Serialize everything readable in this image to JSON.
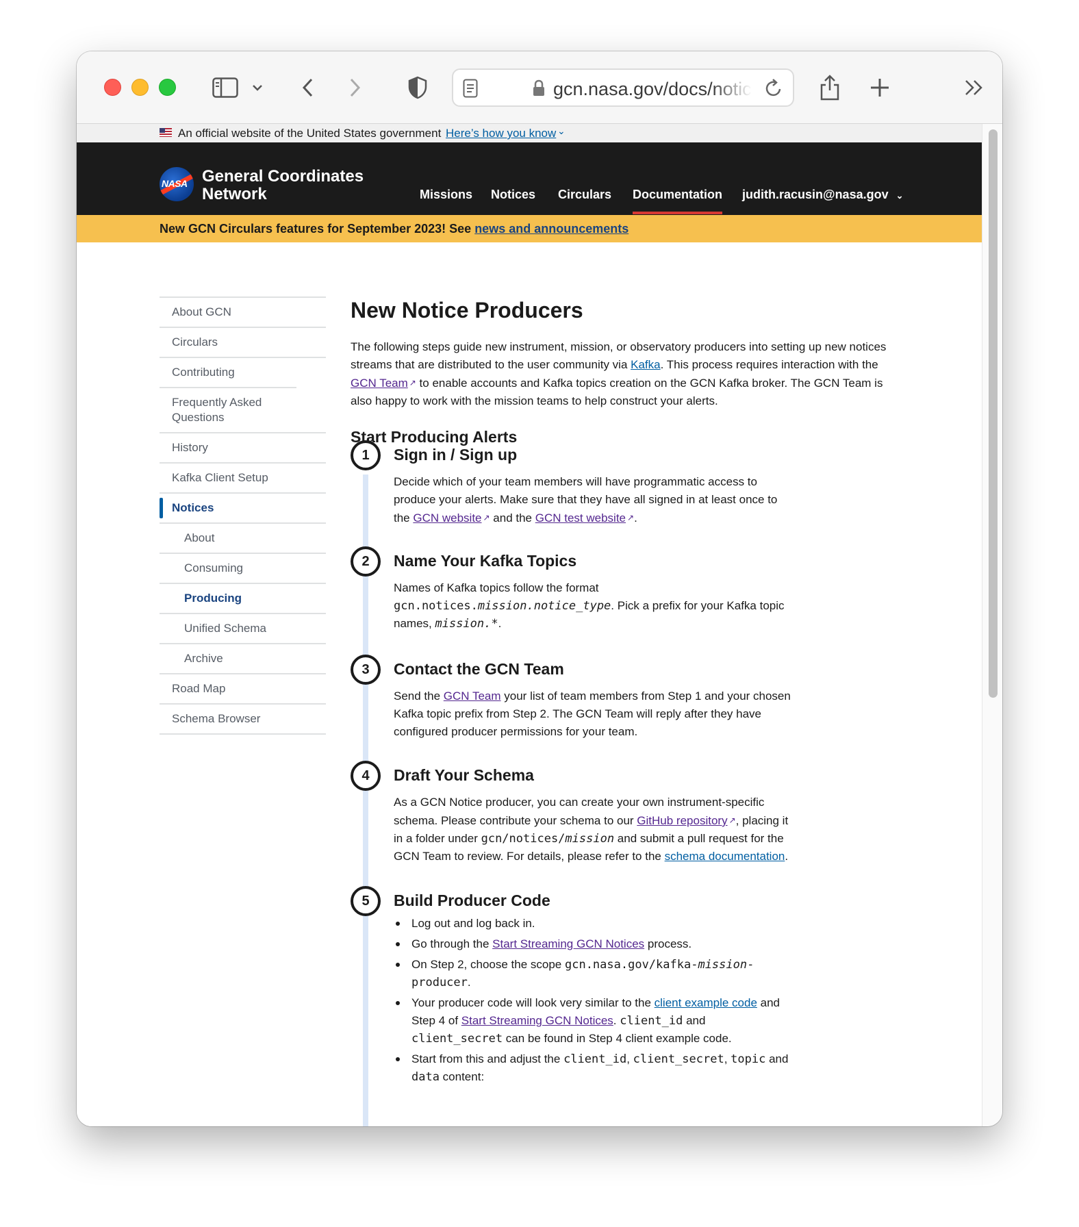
{
  "browser": {
    "url": "gcn.nasa.gov/docs/notices/producers"
  },
  "gov_banner": {
    "text": "An official website of the United States government",
    "link": "Here’s how you know"
  },
  "header": {
    "site_title_line1": "General Coordinates",
    "site_title_line2": "Network",
    "nav": [
      "Missions",
      "Notices",
      "Circulars",
      "Documentation",
      "judith.racusin@nasa.gov"
    ]
  },
  "announcement": {
    "text": "New GCN Circulars features for September 2023! See ",
    "link": "news and announcements"
  },
  "sidebar": {
    "items": [
      {
        "label": "About GCN"
      },
      {
        "label": "Circulars"
      },
      {
        "label": "Contributing"
      },
      {
        "label": "Frequently Asked Questions"
      },
      {
        "label": "History"
      },
      {
        "label": "Kafka Client Setup"
      },
      {
        "label": "Notices"
      },
      {
        "label": "About"
      },
      {
        "label": "Consuming"
      },
      {
        "label": "Producing"
      },
      {
        "label": "Unified Schema"
      },
      {
        "label": "Archive"
      },
      {
        "label": "Road Map"
      },
      {
        "label": "Schema Browser"
      }
    ]
  },
  "main": {
    "title": "New Notice Producers",
    "intro": {
      "t1": "The following steps guide new instrument, mission, or observatory producers into setting up new notices streams that are distributed to the user community via ",
      "kafka": "Kafka",
      "t2": ". This process requires interaction with the ",
      "gcn_team": "GCN Team",
      "t3": " to enable accounts and Kafka topics creation on the GCN Kafka broker. The GCN Team is also happy to work with the mission teams to help construct your alerts."
    },
    "section_title": "Start Producing Alerts",
    "steps": [
      {
        "num": "1",
        "title": "Sign in / Sign up",
        "t1": "Decide which of your team members will have programmatic access to produce your alerts. Make sure that they have all signed in at least once to the ",
        "link1": "GCN website",
        "t2": " and the ",
        "link2": "GCN test website",
        "t3": "."
      },
      {
        "num": "2",
        "title": "Name Your Kafka Topics",
        "t1": "Names of Kafka topics follow the format ",
        "code1": "gcn.notices.",
        "code1_em": "mission.notice_type",
        "t2": ". Pick a prefix for your Kafka topic names, ",
        "code2_em": "mission.*",
        "t3": "."
      },
      {
        "num": "3",
        "title": "Contact the GCN Team",
        "t1": "Send the ",
        "link1": "GCN Team",
        "t2": " your list of team members from Step 1 and your chosen Kafka topic prefix from Step 2. The GCN Team will reply after they have configured producer permissions for your team."
      },
      {
        "num": "4",
        "title": "Draft Your Schema",
        "t1": "As a GCN Notice producer, you can create your own instrument-specific schema. Please contribute your schema to our ",
        "link1": "GitHub repository",
        "t2": ", placing it in a folder under ",
        "code1": "gcn/notices/",
        "code1_em": "mission",
        "t3": " and submit a pull request for the GCN Team to review. For details, please refer to the ",
        "link2": "schema documentation",
        "t4": "."
      },
      {
        "num": "5",
        "title": "Build Producer Code",
        "bullets": {
          "b1": "Log out and log back in.",
          "b2_t1": "Go through the ",
          "b2_link": "Start Streaming GCN Notices",
          "b2_t2": " process.",
          "b3_t1": "On Step 2, choose the scope ",
          "b3_code": "gcn.nasa.gov/kafka-",
          "b3_code_em": "mission",
          "b3_code2": "-producer",
          "b3_t2": ".",
          "b4_t1": "Your producer code will look very similar to the ",
          "b4_link1": "client example code",
          "b4_t2": " and Step 4 of ",
          "b4_link2": "Start Streaming GCN Notices",
          "b4_t3": ". ",
          "b4_code1": "client_id",
          "b4_t4": " and ",
          "b4_code2": "client_secret",
          "b4_t5": " can be found in Step 4 client example code.",
          "b5_t1": "Start from this and adjust the ",
          "b5_code1": "client_id",
          "b5_sep1": ", ",
          "b5_code2": "client_secret",
          "b5_sep2": ", ",
          "b5_code3": "topic",
          "b5_t2": " and ",
          "b5_code4": "data",
          "b5_t3": " content:"
        }
      }
    ]
  }
}
